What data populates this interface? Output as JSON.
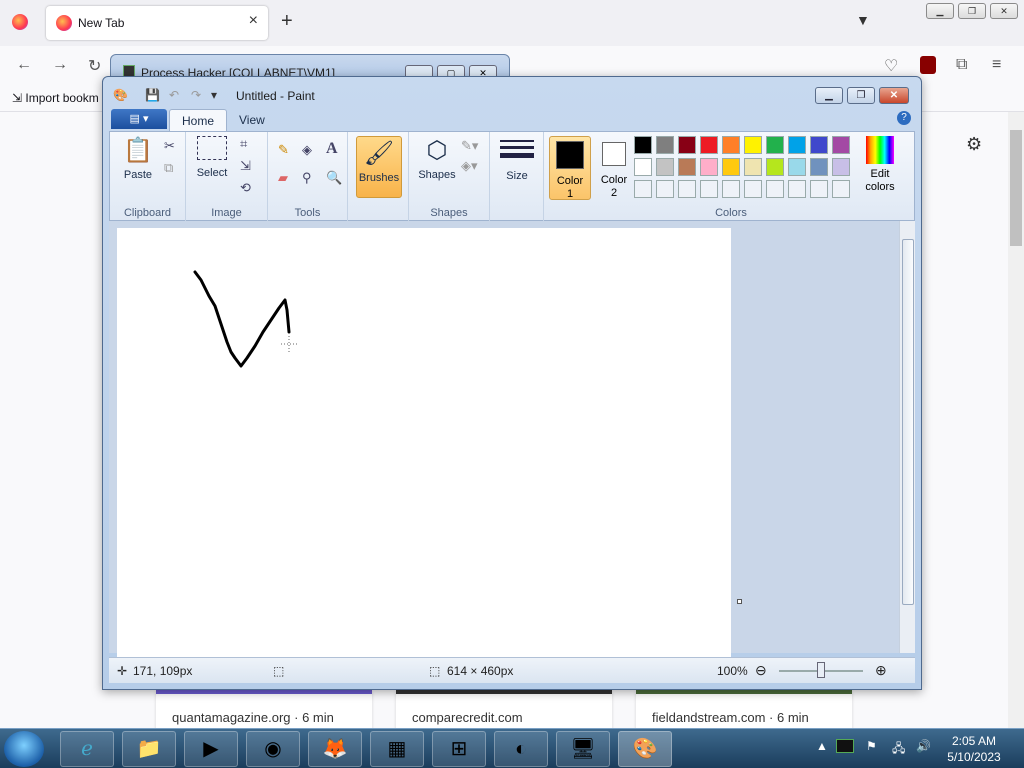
{
  "firefox": {
    "tab_title": "New Tab",
    "bookmark_import": "Import bookm",
    "tiles": [
      "quantamagazine.org · 6 min",
      "comparecredit.com",
      "fieldandstream.com · 6 min"
    ]
  },
  "process_hacker": {
    "title": "Process Hacker [COLLABNET\\VM1]"
  },
  "paint": {
    "title": "Untitled - Paint",
    "tabs": [
      "Home",
      "View"
    ],
    "groups": {
      "clipboard": "Clipboard",
      "image": "Image",
      "tools": "Tools",
      "shapes": "Shapes",
      "colors": "Colors"
    },
    "buttons": {
      "paste": "Paste",
      "select": "Select",
      "brushes": "Brushes",
      "shapes": "Shapes",
      "size": "Size",
      "color1_line1": "Color",
      "color1_line2": "1",
      "color2_line1": "Color",
      "color2_line2": "2",
      "edit_colors_line1": "Edit",
      "edit_colors_line2": "colors"
    },
    "palette_row1": [
      "#000000",
      "#7f7f7f",
      "#880015",
      "#ed1c24",
      "#ff7f27",
      "#fff200",
      "#22b14c",
      "#00a2e8",
      "#3f48cc",
      "#a349a4"
    ],
    "palette_row2": [
      "#ffffff",
      "#c3c3c3",
      "#b97a57",
      "#ffaec9",
      "#ffc90e",
      "#efe4b0",
      "#b5e61d",
      "#99d9ea",
      "#7092be",
      "#c8bfe7"
    ],
    "status": {
      "cursor_pos": "171, 109px",
      "canvas_size": "614 × 460px",
      "zoom": "100%"
    }
  },
  "taskbar": {
    "time": "2:05 AM",
    "date": "5/10/2023"
  }
}
